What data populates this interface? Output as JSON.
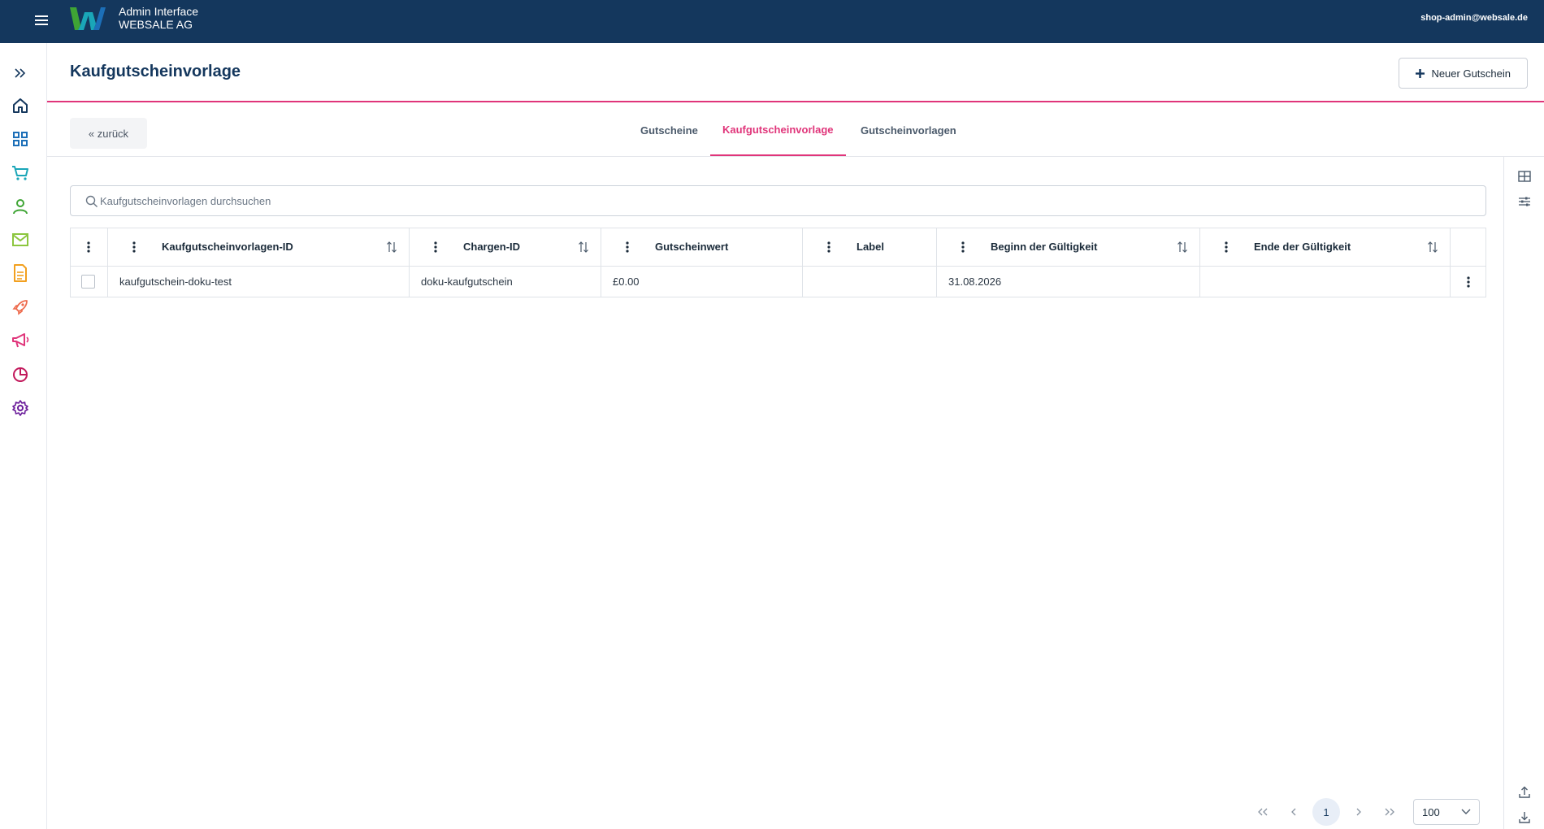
{
  "topbar": {
    "brand_line1": "Admin Interface",
    "brand_line2": "WEBSALE AG",
    "user_email": "shop-admin@websale.de",
    "logo_letter": "W"
  },
  "leftnav": {
    "items": [
      {
        "icon": "expand-icon",
        "color": "#14375d"
      },
      {
        "icon": "home-icon",
        "color": "#14375d"
      },
      {
        "icon": "grid-icon",
        "color": "#1c6fb8"
      },
      {
        "icon": "cart-icon",
        "color": "#1aa6b8"
      },
      {
        "icon": "user-icon",
        "color": "#3fa535"
      },
      {
        "icon": "mail-icon",
        "color": "#8cc63f"
      },
      {
        "icon": "document-icon",
        "color": "#f2a01f"
      },
      {
        "icon": "rocket-icon",
        "color": "#ee6b4d"
      },
      {
        "icon": "megaphone-icon",
        "color": "#e0357a"
      },
      {
        "icon": "pie-chart-icon",
        "color": "#c2185b"
      },
      {
        "icon": "gear-icon",
        "color": "#6a1b9a"
      }
    ]
  },
  "header": {
    "title": "Kaufgutscheinvorlage",
    "new_button_label": "Neuer Gutschein"
  },
  "subbar": {
    "back_label": "« zurück",
    "tabs": [
      {
        "label": "Gutscheine",
        "active": false
      },
      {
        "label": "Kaufgutscheinvorlage",
        "active": true
      },
      {
        "label": "Gutscheinvorlagen",
        "active": false
      }
    ]
  },
  "search": {
    "placeholder": "Kaufgutscheinvorlagen durchsuchen",
    "value": ""
  },
  "table": {
    "columns": [
      {
        "label": "Kaufgutscheinvorlagen-ID",
        "sortable": true
      },
      {
        "label": "Chargen-ID",
        "sortable": true
      },
      {
        "label": "Gutscheinwert",
        "sortable": false
      },
      {
        "label": "Label",
        "sortable": false
      },
      {
        "label": "Beginn der Gültigkeit",
        "sortable": true
      },
      {
        "label": "Ende der Gültigkeit",
        "sortable": true
      }
    ],
    "rows": [
      {
        "checked": false,
        "cells": [
          "kaufgutschein-doku-test",
          "doku-kaufgutschein",
          "£0.00",
          "",
          "31.08.2026",
          ""
        ]
      }
    ]
  },
  "pagination": {
    "current_page": "1",
    "page_size": "100"
  },
  "colors": {
    "topbar": "#14375d",
    "accent": "#e0357a"
  }
}
